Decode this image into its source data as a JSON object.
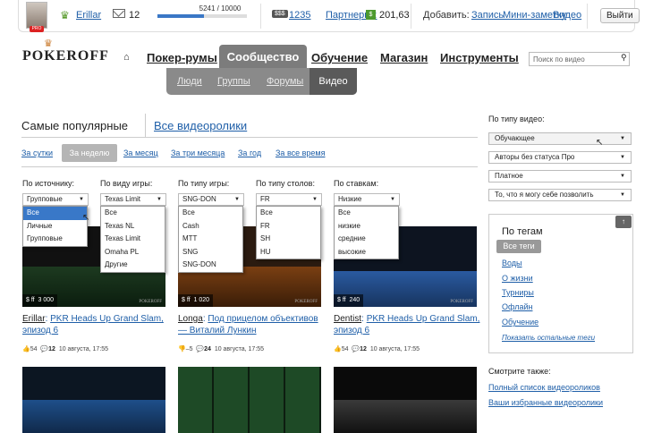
{
  "topbar": {
    "username": "Erillar",
    "mail_count": "12",
    "xp_text": "5241 / 10000",
    "xp_fraction": 0.5241,
    "rank_value": "1235",
    "partner_label": "Партнерка:",
    "money_value": "201,63",
    "add_label": "Добавить:",
    "add_post": "Запись",
    "add_note": "Мини-заметку",
    "add_video": "Видео",
    "logout": "Выйти"
  },
  "logo": "POKEROFF",
  "nav": {
    "items": [
      "Покер-румы",
      "Сообщество",
      "Обучение",
      "Магазин",
      "Инструменты"
    ],
    "subitems": [
      "Люди",
      "Группы",
      "Форумы",
      "Видео"
    ]
  },
  "search": {
    "placeholder": "Поиск по видео"
  },
  "tabs": {
    "popular": "Самые популярные",
    "all": "Все видеоролики"
  },
  "periods": [
    "За сутки",
    "За неделю",
    "За месяц",
    "За три месяца",
    "За год",
    "За все время"
  ],
  "filters": [
    {
      "label": "По источнику:",
      "value": "Групповые",
      "options": [
        "Все",
        "Личные",
        "Групповые"
      ]
    },
    {
      "label": "По виду игры:",
      "value": "Texas Limit",
      "options": [
        "Все",
        "Texas NL",
        "Texas Limit",
        "Omaha PL",
        "Другие"
      ]
    },
    {
      "label": "По типу игры:",
      "value": "SNG-DON",
      "options": [
        "Все",
        "Cash",
        "MTT",
        "SNG",
        "SNG-DON"
      ]
    },
    {
      "label": "По типу столов:",
      "value": "FR",
      "options": [
        "Все",
        "FR",
        "SH",
        "HU"
      ]
    },
    {
      "label": "По ставкам:",
      "value": "Низкие",
      "options": [
        "Все",
        "низкие",
        "средние",
        "высокие"
      ]
    }
  ],
  "videos": [
    {
      "stake": "$ ff",
      "views": "3 000",
      "author": "Erillar",
      "title": "PKR Heads Up Grand Slam, эпизод 6",
      "likes": "54",
      "comments": "12",
      "date": "10 августа, 17:55"
    },
    {
      "stake": "$ ff",
      "views": "1 020",
      "author": "Longa",
      "title": "Под прицелом объективов — Виталий Лункин",
      "likes": "–5",
      "comments": "24",
      "date": "10 августа, 17:55"
    },
    {
      "stake": "$ ff",
      "views": "240",
      "author": "Dentist",
      "title": "PKR Heads Up Grand Slam, эпизод 6",
      "likes": "54",
      "comments": "12",
      "date": "10 августа, 17:55"
    }
  ],
  "thumb_brand": "POKEROFF",
  "right": {
    "type_label": "По типу видео:",
    "selects": [
      "Обучающее",
      "Авторы без статуса Про",
      "Платное",
      "То, что я могу себе позволить"
    ],
    "tags_title": "По тегам",
    "tags_all": "Все теги",
    "tags": [
      "Воды",
      "О жизни",
      "Турниры",
      "Офлайн",
      "Обучение"
    ],
    "tags_more": "Показать остальные теги",
    "see_also": "Смотрите также:",
    "links": [
      "Полный список видеороликов",
      "Ваши избранные видеоролики"
    ]
  }
}
